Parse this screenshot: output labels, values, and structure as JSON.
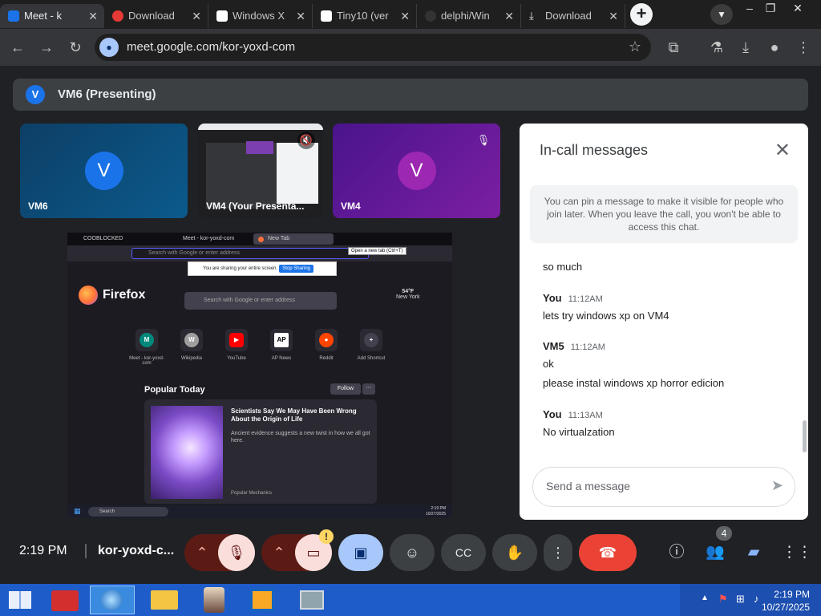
{
  "browser": {
    "tabs": [
      {
        "title": "Meet - k",
        "favicon_color": "#1a73e8"
      },
      {
        "title": "Download",
        "favicon_color": "#e53935"
      },
      {
        "title": "Windows X",
        "favicon_color": "#ffffff"
      },
      {
        "title": "Tiny10 (ver",
        "favicon_color": "#ffffff"
      },
      {
        "title": "delphi/Win",
        "favicon_color": "#333333"
      },
      {
        "title": "Download",
        "favicon_color": "#e8eaed"
      }
    ],
    "new_tab_symbol": "+",
    "url": "meet.google.com/kor-yoxd-com"
  },
  "meet": {
    "presenting_avatar": "V",
    "presenting_label": "VM6 (Presenting)",
    "tiles": [
      {
        "name": "VM6",
        "avatar": "V",
        "color": "#0b5a8c"
      },
      {
        "name": "VM4 (Your Presenta...",
        "avatar": "",
        "color": "#333333"
      },
      {
        "name": "VM4",
        "avatar": "V",
        "color": "#6a1b9a"
      }
    ],
    "shared_screen": {
      "tabs": [
        "COOBLOCKED",
        "Meet - kor-yoxd-com",
        "New Tab"
      ],
      "tooltip": "Open a new tab (Ctrl+T)",
      "url_placeholder": "Search with Google or enter address",
      "share_warning": "You are sharing your entire screen.",
      "stop_sharing": "Stop Sharing",
      "brand": "Firefox",
      "search_placeholder": "Search with Google or enter address",
      "weather_temp": "54°F",
      "weather_city": "New York",
      "shortcuts": [
        {
          "label": "Meet - kor-yoxd-com",
          "glyph": "M",
          "color": "#00897b"
        },
        {
          "label": "Wikipedia",
          "glyph": "W",
          "color": "#9e9e9e"
        },
        {
          "label": "YouTube",
          "glyph": "▶",
          "color": "#ff0000"
        },
        {
          "label": "AP News",
          "glyph": "AP",
          "color": "#ffffff"
        },
        {
          "label": "Reddit",
          "glyph": "●",
          "color": "#ff4500"
        },
        {
          "label": "Add Shortcut",
          "glyph": "+",
          "color": "#42414d"
        }
      ],
      "popular_heading": "Popular Today",
      "follow_label": "Follow",
      "story_title": "Scientists Say We May Have Been Wrong About the Origin of Life",
      "story_desc": "Ancient evidence suggests a new twist in how we all got here.",
      "story_source": "Popular Mechanics",
      "taskbar_search": "Search",
      "taskbar_time": "2:19 PM",
      "taskbar_date": "10/27/2025"
    }
  },
  "chat": {
    "title": "In-call messages",
    "pin_note": "You can pin a message to make it visible for people who join later. When you leave the call, you won't be able to access this chat.",
    "messages": [
      {
        "sender": "",
        "time": "",
        "text": "so much"
      },
      {
        "sender": "You",
        "time": "11:12AM",
        "text": "lets try windows xp on VM4"
      },
      {
        "sender": "VM5",
        "time": "11:12AM",
        "text": "ok"
      },
      {
        "sender": "",
        "time": "",
        "text": "please instal windows xp horror edicion"
      },
      {
        "sender": "You",
        "time": "11:13AM",
        "text": "No virtualzation"
      }
    ],
    "composer_placeholder": "Send a message"
  },
  "controls": {
    "time": "2:19 PM",
    "meeting_code": "kor-yoxd-c...",
    "camera_warning_badge": "!",
    "people_count": "4",
    "end_call_color": "#ea4335"
  },
  "taskbar": {
    "time": "2:19 PM",
    "date": "10/27/2025"
  }
}
